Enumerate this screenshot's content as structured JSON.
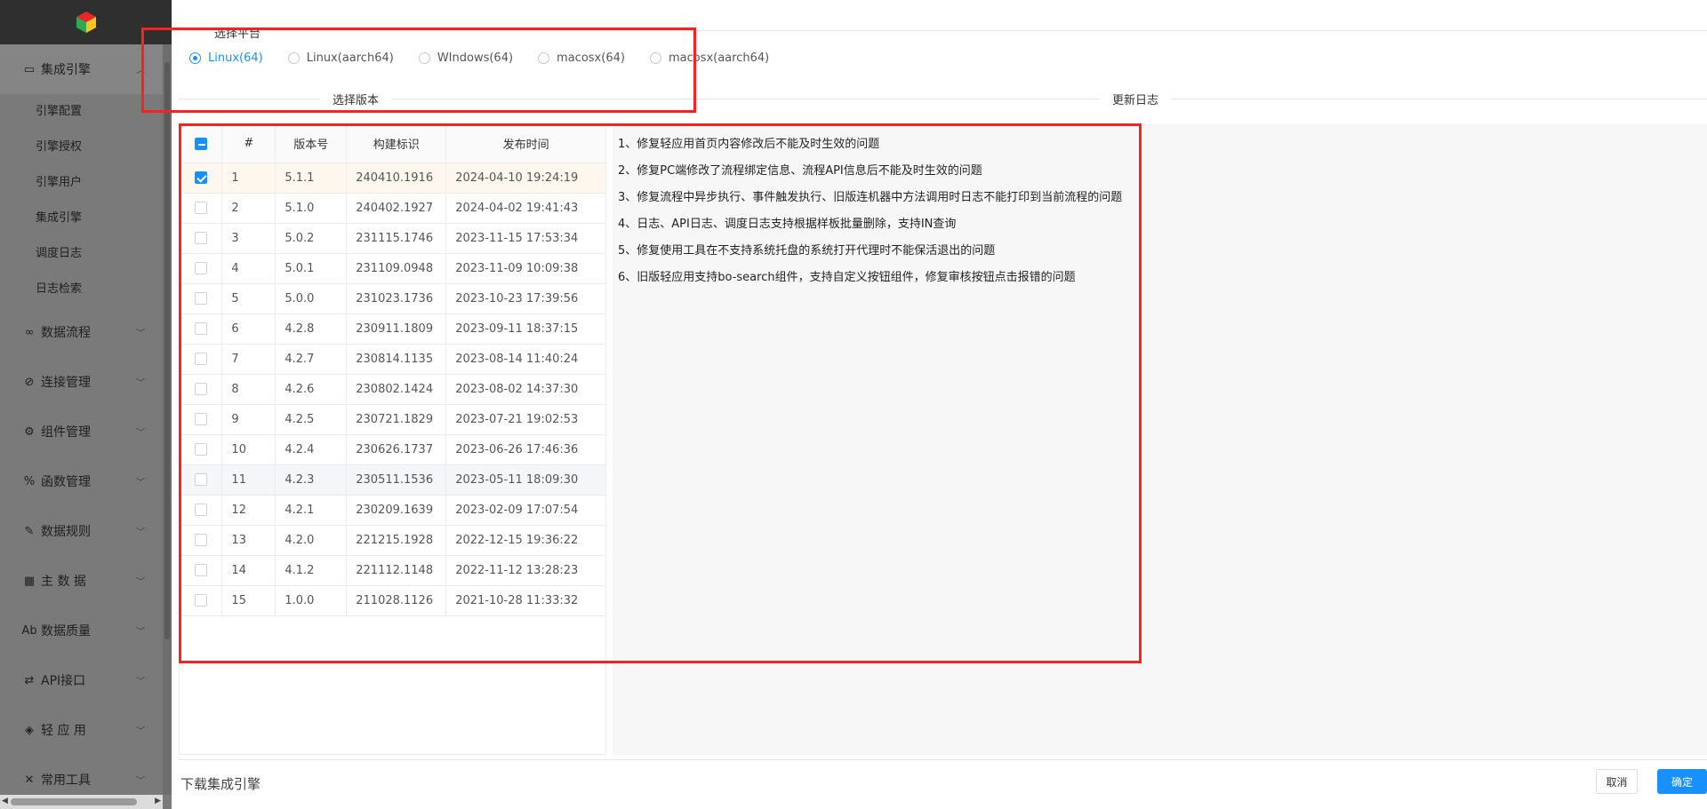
{
  "sidebar": {
    "groups": [
      {
        "icon": "monitor-icon",
        "glyph": "▭",
        "label": "集成引擎",
        "open": true,
        "items": [
          "引擎配置",
          "引擎授权",
          "引擎用户",
          "集成引擎",
          "调度日志",
          "日志检索"
        ]
      },
      {
        "icon": "infinity-icon",
        "glyph": "∞",
        "label": "数据流程"
      },
      {
        "icon": "link-icon",
        "glyph": "⊘",
        "label": "连接管理"
      },
      {
        "icon": "components-icon",
        "glyph": "⚙",
        "label": "组件管理"
      },
      {
        "icon": "percent-icon",
        "glyph": "%",
        "label": "函数管理"
      },
      {
        "icon": "brush-icon",
        "glyph": "✎",
        "label": "数据规则"
      },
      {
        "icon": "map-icon",
        "glyph": "▦",
        "label": "主 数 据"
      },
      {
        "icon": "spellcheck-icon",
        "glyph": "Ab",
        "label": "数据质量"
      },
      {
        "icon": "swap-icon",
        "glyph": "⇄",
        "label": "API接口"
      },
      {
        "icon": "cube-icon",
        "glyph": "◈",
        "label": "轻 应 用"
      },
      {
        "icon": "tools-icon",
        "glyph": "✕",
        "label": "常用工具"
      }
    ]
  },
  "platform": {
    "label": "选择平台",
    "options": [
      "Linux(64)",
      "Linux(aarch64)",
      "WIndows(64)",
      "macosx(64)",
      "macosx(aarch64)"
    ],
    "selected": "Linux(64)"
  },
  "section_titles": {
    "versions": "选择版本",
    "changelog": "更新日志"
  },
  "table": {
    "columns": [
      "#",
      "版本号",
      "构建标识",
      "发布时间"
    ],
    "rows": [
      {
        "no": "1",
        "version": "5.1.1",
        "build": "240410.1916",
        "date": "2024-04-10 19:24:19",
        "checked": true
      },
      {
        "no": "2",
        "version": "5.1.0",
        "build": "240402.1927",
        "date": "2024-04-02 19:41:43",
        "checked": false
      },
      {
        "no": "3",
        "version": "5.0.2",
        "build": "231115.1746",
        "date": "2023-11-15 17:53:34",
        "checked": false
      },
      {
        "no": "4",
        "version": "5.0.1",
        "build": "231109.0948",
        "date": "2023-11-09 10:09:38",
        "checked": false
      },
      {
        "no": "5",
        "version": "5.0.0",
        "build": "231023.1736",
        "date": "2023-10-23 17:39:56",
        "checked": false
      },
      {
        "no": "6",
        "version": "4.2.8",
        "build": "230911.1809",
        "date": "2023-09-11 18:37:15",
        "checked": false
      },
      {
        "no": "7",
        "version": "4.2.7",
        "build": "230814.1135",
        "date": "2023-08-14 11:40:24",
        "checked": false
      },
      {
        "no": "8",
        "version": "4.2.6",
        "build": "230802.1424",
        "date": "2023-08-02 14:37:30",
        "checked": false
      },
      {
        "no": "9",
        "version": "4.2.5",
        "build": "230721.1829",
        "date": "2023-07-21 19:02:53",
        "checked": false
      },
      {
        "no": "10",
        "version": "4.2.4",
        "build": "230626.1737",
        "date": "2023-06-26 17:46:36",
        "checked": false
      },
      {
        "no": "11",
        "version": "4.2.3",
        "build": "230511.1536",
        "date": "2023-05-11 18:09:30",
        "checked": false
      },
      {
        "no": "12",
        "version": "4.2.1",
        "build": "230209.1639",
        "date": "2023-02-09 17:07:54",
        "checked": false
      },
      {
        "no": "13",
        "version": "4.2.0",
        "build": "221215.1928",
        "date": "2022-12-15 19:36:22",
        "checked": false
      },
      {
        "no": "14",
        "version": "4.1.2",
        "build": "221112.1148",
        "date": "2022-11-12 13:28:23",
        "checked": false
      },
      {
        "no": "15",
        "version": "1.0.0",
        "build": "211028.1126",
        "date": "2021-10-28 11:33:32",
        "checked": false
      }
    ]
  },
  "changelog": [
    "1、修复轻应用首页内容修改后不能及时生效的问题",
    "2、修复PC端修改了流程绑定信息、流程API信息后不能及时生效的问题",
    "3、修复流程中异步执行、事件触发执行、旧版连机器中方法调用时日志不能打印到当前流程的问题",
    "4、日志、API日志、调度日志支持根据样板批量删除，支持IN查询",
    "5、修复使用工具在不支持系统托盘的系统打开代理时不能保活退出的问题",
    "6、旧版轻应用支持bo-search组件，支持自定义按钮组件，修复审核按钮点击报错的问题"
  ],
  "footer": {
    "title": "下载集成引擎",
    "cancel": "取消",
    "ok": "确定"
  },
  "colors": {
    "accent": "#1890ff",
    "highlight": "#ff2020",
    "sidebar": "#7a7a7a",
    "selected_row": "#fdf7ee"
  }
}
